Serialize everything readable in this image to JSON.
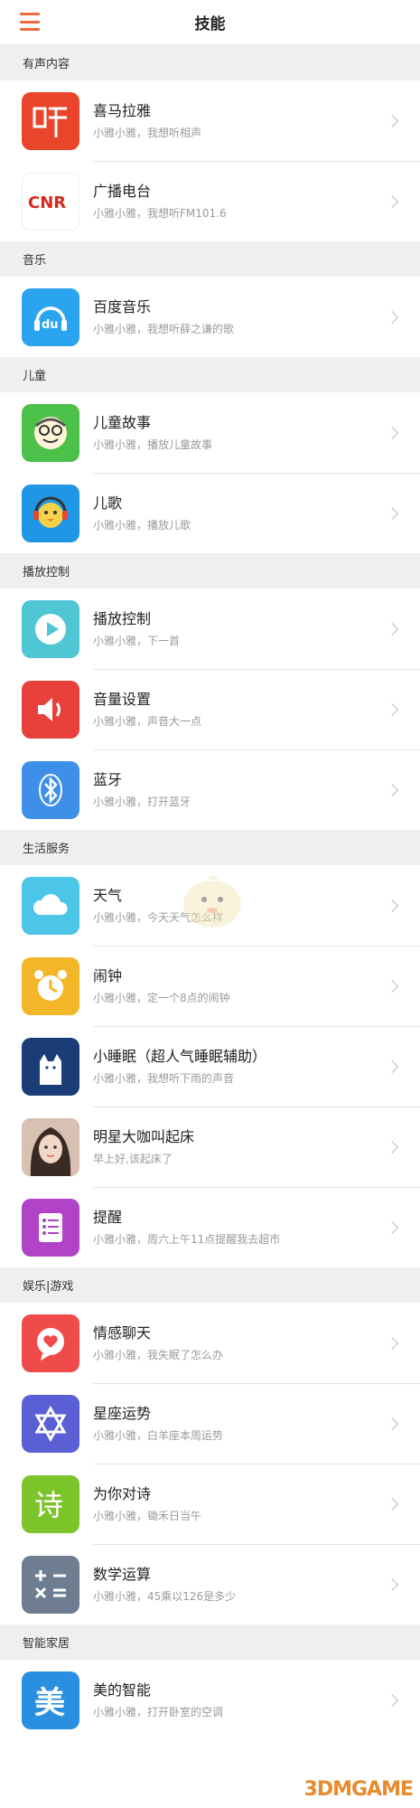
{
  "header": {
    "title": "技能"
  },
  "sections": [
    {
      "title": "有声内容",
      "items": [
        {
          "name": "喜马拉雅",
          "desc": "小雅小雅，我想听相声",
          "icon": "ximalaya-icon",
          "color": "#e8452a"
        },
        {
          "name": "广播电台",
          "desc": "小雅小雅，我想听FM101.6",
          "icon": "cnr-icon",
          "color": "#ffffff"
        }
      ]
    },
    {
      "title": "音乐",
      "items": [
        {
          "name": "百度音乐",
          "desc": "小雅小雅，我想听薛之谦的歌",
          "icon": "baidu-music-icon",
          "color": "#2aa3f0"
        }
      ]
    },
    {
      "title": "儿童",
      "items": [
        {
          "name": "儿童故事",
          "desc": "小雅小雅，播放儿童故事",
          "icon": "kids-story-icon",
          "color": "#4cc14a"
        },
        {
          "name": "儿歌",
          "desc": "小雅小雅，播放儿歌",
          "icon": "kids-song-icon",
          "color": "#2096e6"
        }
      ]
    },
    {
      "title": "播放控制",
      "items": [
        {
          "name": "播放控制",
          "desc": "小雅小雅，下一首",
          "icon": "play-icon",
          "color": "#4fc6d4"
        },
        {
          "name": "音量设置",
          "desc": "小雅小雅，声音大一点",
          "icon": "volume-icon",
          "color": "#e8413b"
        },
        {
          "name": "蓝牙",
          "desc": "小雅小雅，打开蓝牙",
          "icon": "bluetooth-icon",
          "color": "#3e8fe8"
        }
      ]
    },
    {
      "title": "生活服务",
      "items": [
        {
          "name": "天气",
          "desc": "小雅小雅，今天天气怎么样",
          "icon": "weather-icon",
          "color": "#4cc6e8"
        },
        {
          "name": "闹钟",
          "desc": "小雅小雅，定一个8点的闹钟",
          "icon": "alarm-icon",
          "color": "#f3b628"
        },
        {
          "name": "小睡眠（超人气睡眠辅助）",
          "desc": "小雅小雅，我想听下雨的声音",
          "icon": "sleep-icon",
          "color": "#1a3d77"
        },
        {
          "name": "明星大咖叫起床",
          "desc": "早上好,该起床了",
          "icon": "celebrity-avatar",
          "color": "#c9a08d"
        },
        {
          "name": "提醒",
          "desc": "小雅小雅，周六上午11点提醒我去超市",
          "icon": "reminder-icon",
          "color": "#b143c8"
        }
      ]
    },
    {
      "title": "娱乐|游戏",
      "items": [
        {
          "name": "情感聊天",
          "desc": "小雅小雅，我失眠了怎么办",
          "icon": "heart-chat-icon",
          "color": "#ef4b4b"
        },
        {
          "name": "星座运势",
          "desc": "小雅小雅，白羊座本周运势",
          "icon": "star-sign-icon",
          "color": "#5a5fd6"
        },
        {
          "name": "为你对诗",
          "desc": "小雅小雅，锄禾日当午",
          "icon": "poem-icon",
          "color": "#7dc42a"
        },
        {
          "name": "数学运算",
          "desc": "小雅小雅，45乘以126是多少",
          "icon": "math-icon",
          "color": "#6f7d90"
        }
      ]
    },
    {
      "title": "智能家居",
      "items": [
        {
          "name": "美的智能",
          "desc": "小雅小雅，打开卧室的空调",
          "icon": "midea-icon",
          "color": "#2a8fe0"
        }
      ]
    }
  ],
  "footer": {
    "watermark": "3DMGAME"
  }
}
